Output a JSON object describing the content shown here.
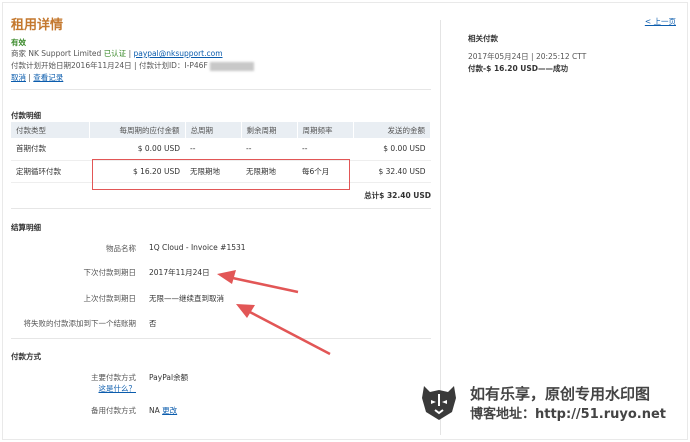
{
  "page": {
    "title": "租用详情",
    "status": "有效",
    "merchant_prefix": "商家 NK Support Limited ",
    "verified": "已认证",
    "separator": " | ",
    "email": "paypal@nksupport.com",
    "plan_line": "付款计划开始日期2016年11月24日 | 付款计划ID：",
    "plan_id_prefix": "I-P46F",
    "cancel_link": "取消",
    "history_link": "查看记录"
  },
  "payment_details": {
    "heading": "付款明细",
    "columns": [
      "付款类型",
      "每周期的应付金额",
      "总周期",
      "剩余周期",
      "周期频率",
      "发送的金额"
    ],
    "rows": [
      [
        "首期付款",
        "$ 0.00 USD",
        "--",
        "--",
        "--",
        "$ 0.00 USD"
      ],
      [
        "定期循环付款",
        "$ 16.20 USD",
        "无限期地",
        "无限期地",
        "每6个月",
        "$ 32.40 USD"
      ]
    ],
    "total": "总计$ 32.40 USD"
  },
  "billing": {
    "heading": "结算明细",
    "items": [
      {
        "label": "物品名称",
        "value": "1Q Cloud - Invoice #1531"
      },
      {
        "label": "下次付款到期日",
        "value": "2017年11月24日"
      },
      {
        "label": "上次付款到期日",
        "value": "无限——继续直到取消"
      },
      {
        "label": "将失败的付款添加到下一个结账期",
        "value": "否"
      }
    ]
  },
  "payment_method": {
    "heading": "付款方式",
    "primary_label": "主要付款方式",
    "whats_this": "这是什么？",
    "primary_value": "PayPal余额",
    "backup_label": "备用付款方式",
    "backup_value": "NA ",
    "change_link": "更改"
  },
  "sidebar": {
    "prev_link": "< 上一页",
    "heading": "相关付款",
    "date": "2017年05月24日 | 20:25:12 CTT",
    "payment": "付款-$ 16.20 USD——成功"
  },
  "watermark": {
    "line1": "如有乐享，原创专用水印图",
    "line2": "博客地址：http://51.ruyo.net"
  },
  "colors": {
    "title": "#c4782e",
    "status": "#3a8a2a",
    "link": "#0b5cad",
    "annotation": "#e25656"
  }
}
